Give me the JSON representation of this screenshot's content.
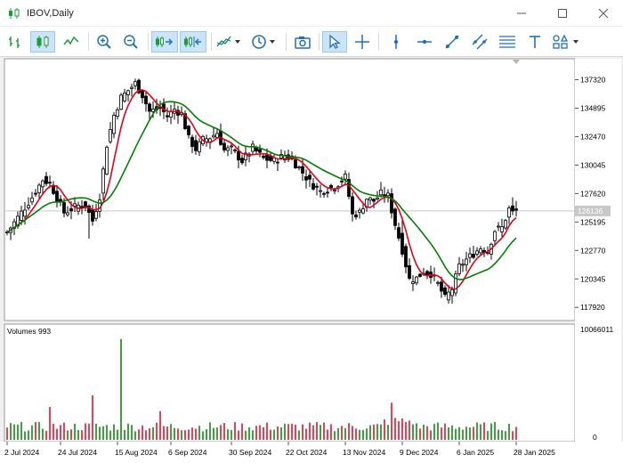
{
  "window": {
    "title": "IBOV,Daily"
  },
  "toolbar": {
    "items": [
      {
        "name": "bar-chart-button"
      },
      {
        "name": "candlestick-chart-button"
      },
      {
        "name": "line-chart-button"
      },
      {
        "name": "zoom-in-button"
      },
      {
        "name": "zoom-out-button"
      },
      {
        "name": "auto-scroll-button"
      },
      {
        "name": "chart-shift-button"
      },
      {
        "name": "indicators-button"
      },
      {
        "name": "periods-button"
      },
      {
        "name": "screenshot-button"
      },
      {
        "name": "cursor-button"
      },
      {
        "name": "crosshair-button"
      },
      {
        "name": "vertical-line-button"
      },
      {
        "name": "horizontal-line-button"
      },
      {
        "name": "trendline-button"
      },
      {
        "name": "channel-button"
      },
      {
        "name": "fibonacci-button"
      },
      {
        "name": "text-button"
      },
      {
        "name": "shapes-button"
      }
    ]
  },
  "chart_data": {
    "type": "candlestick",
    "symbol": "IBOV",
    "timeframe": "Daily",
    "price_axis": {
      "ticks": [
        137320,
        134895,
        132470,
        130045,
        127620,
        125195,
        122770,
        120345,
        117920
      ],
      "ylim": [
        116800,
        139100
      ],
      "current_price": 126136,
      "current_price_label": "126136"
    },
    "time_axis": {
      "labels": [
        "2 Jul 2024",
        "24 Jul 2024",
        "15 Aug 2024",
        "6 Sep 2024",
        "30 Sep 2024",
        "22 Oct 2024",
        "13 Nov 2024",
        "9 Dec 2024",
        "6 Jan 2025",
        "28 Jan 2025"
      ],
      "label_bar_index": [
        0,
        15,
        31,
        46,
        63,
        79,
        95,
        111,
        127,
        143
      ]
    },
    "moving_averages": [
      {
        "color": "#e0001b",
        "period_hint": "fast"
      },
      {
        "color": "#008000",
        "period_hint": "slow"
      }
    ],
    "close_anchors": [
      [
        0,
        124300
      ],
      [
        4,
        126000
      ],
      [
        7,
        127300
      ],
      [
        10,
        128800
      ],
      [
        12,
        128500
      ],
      [
        16,
        126000
      ],
      [
        20,
        126600
      ],
      [
        22,
        126600
      ],
      [
        24,
        125300
      ],
      [
        26,
        127400
      ],
      [
        28,
        131800
      ],
      [
        30,
        134300
      ],
      [
        32,
        135800
      ],
      [
        34,
        136400
      ],
      [
        36,
        137000
      ],
      [
        38,
        136000
      ],
      [
        40,
        134600
      ],
      [
        43,
        134900
      ],
      [
        45,
        134200
      ],
      [
        47,
        134800
      ],
      [
        49,
        134400
      ],
      [
        51,
        132300
      ],
      [
        53,
        131400
      ],
      [
        55,
        132200
      ],
      [
        57,
        132400
      ],
      [
        59,
        132800
      ],
      [
        61,
        131300
      ],
      [
        63,
        131400
      ],
      [
        66,
        130400
      ],
      [
        69,
        131500
      ],
      [
        72,
        130600
      ],
      [
        75,
        130400
      ],
      [
        78,
        130900
      ],
      [
        80,
        130500
      ],
      [
        82,
        129800
      ],
      [
        85,
        128600
      ],
      [
        88,
        127800
      ],
      [
        92,
        128200
      ],
      [
        95,
        129000
      ],
      [
        97,
        125800
      ],
      [
        99,
        126000
      ],
      [
        101,
        127200
      ],
      [
        103,
        127000
      ],
      [
        105,
        127600
      ],
      [
        107,
        127400
      ],
      [
        109,
        125000
      ],
      [
        111,
        122800
      ],
      [
        113,
        120300
      ],
      [
        115,
        120400
      ],
      [
        117,
        121000
      ],
      [
        119,
        120800
      ],
      [
        121,
        119900
      ],
      [
        123,
        118700
      ],
      [
        125,
        119500
      ],
      [
        127,
        121400
      ],
      [
        129,
        122000
      ],
      [
        131,
        122500
      ],
      [
        133,
        123000
      ],
      [
        135,
        122700
      ],
      [
        137,
        124500
      ],
      [
        139,
        124700
      ],
      [
        141,
        126300
      ],
      [
        142,
        126136
      ]
    ],
    "volumes": {
      "label": "Volumes 993",
      "axis_max_label": "10066011",
      "axis_min_label": "0",
      "ylim": [
        0,
        10066011
      ],
      "highlighted": [
        {
          "bar": 12,
          "value": 3100000
        },
        {
          "bar": 24,
          "value": 4200000
        },
        {
          "bar": 32,
          "value": 9500000
        },
        {
          "bar": 43,
          "value": 2700000
        },
        {
          "bar": 108,
          "value": 3500000
        }
      ]
    },
    "mouse_readout": ""
  }
}
